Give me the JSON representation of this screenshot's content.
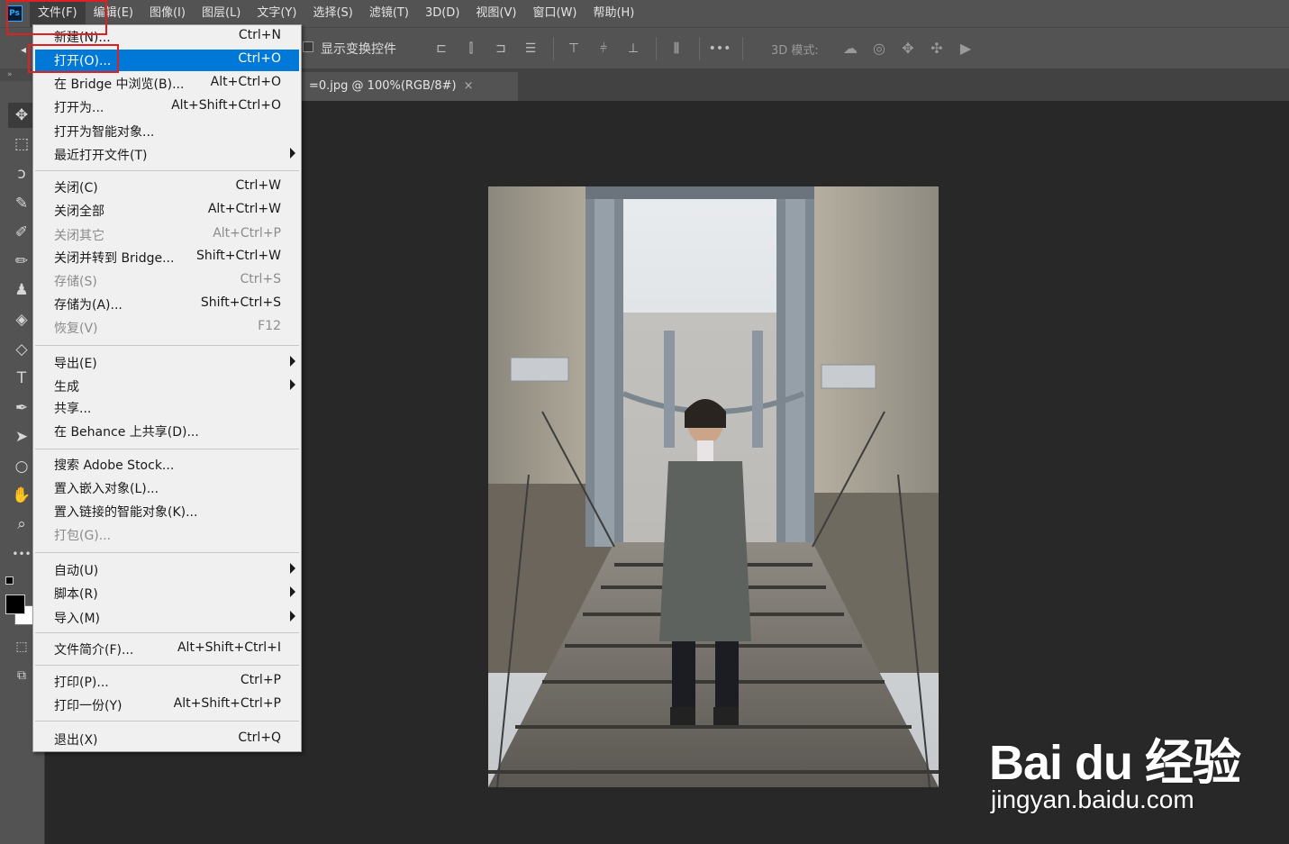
{
  "app": {
    "logo_text": "Ps"
  },
  "menubar": {
    "items": [
      "文件(F)",
      "编辑(E)",
      "图像(I)",
      "图层(L)",
      "文字(Y)",
      "选择(S)",
      "滤镜(T)",
      "3D(D)",
      "视图(V)",
      "窗口(W)",
      "帮助(H)"
    ]
  },
  "options_bar": {
    "show_transform_label": "显示变换控件",
    "show_transform_checked": false,
    "more_label": "•••",
    "mode_3d_label": "3D 模式:"
  },
  "document": {
    "tab_title": "=0.jpg @ 100%(RGB/8#)",
    "close_glyph": "×"
  },
  "file_menu": {
    "items": [
      {
        "label": "新建(N)...",
        "shortcut": "Ctrl+N",
        "disabled": false,
        "submenu": false
      },
      {
        "label": "打开(O)...",
        "shortcut": "Ctrl+O",
        "disabled": false,
        "submenu": false,
        "highlighted": true
      },
      {
        "label": "在 Bridge 中浏览(B)...",
        "shortcut": "Alt+Ctrl+O",
        "disabled": false,
        "submenu": false
      },
      {
        "label": "打开为...",
        "shortcut": "Alt+Shift+Ctrl+O",
        "disabled": false,
        "submenu": false
      },
      {
        "label": "打开为智能对象...",
        "shortcut": "",
        "disabled": false,
        "submenu": false
      },
      {
        "label": "最近打开文件(T)",
        "shortcut": "",
        "disabled": false,
        "submenu": true
      },
      {
        "label": "关闭(C)",
        "shortcut": "Ctrl+W",
        "disabled": false,
        "submenu": false
      },
      {
        "label": "关闭全部",
        "shortcut": "Alt+Ctrl+W",
        "disabled": false,
        "submenu": false
      },
      {
        "label": "关闭其它",
        "shortcut": "Alt+Ctrl+P",
        "disabled": true,
        "submenu": false
      },
      {
        "label": "关闭并转到 Bridge...",
        "shortcut": "Shift+Ctrl+W",
        "disabled": false,
        "submenu": false
      },
      {
        "label": "存储(S)",
        "shortcut": "Ctrl+S",
        "disabled": true,
        "submenu": false
      },
      {
        "label": "存储为(A)...",
        "shortcut": "Shift+Ctrl+S",
        "disabled": false,
        "submenu": false
      },
      {
        "label": "恢复(V)",
        "shortcut": "F12",
        "disabled": true,
        "submenu": false
      },
      {
        "label": "导出(E)",
        "shortcut": "",
        "disabled": false,
        "submenu": true
      },
      {
        "label": "生成",
        "shortcut": "",
        "disabled": false,
        "submenu": true
      },
      {
        "label": "共享...",
        "shortcut": "",
        "disabled": false,
        "submenu": false
      },
      {
        "label": "在 Behance 上共享(D)...",
        "shortcut": "",
        "disabled": false,
        "submenu": false
      },
      {
        "label": "搜索 Adobe Stock...",
        "shortcut": "",
        "disabled": false,
        "submenu": false
      },
      {
        "label": "置入嵌入对象(L)...",
        "shortcut": "",
        "disabled": false,
        "submenu": false
      },
      {
        "label": "置入链接的智能对象(K)...",
        "shortcut": "",
        "disabled": false,
        "submenu": false
      },
      {
        "label": "打包(G)...",
        "shortcut": "",
        "disabled": true,
        "submenu": false
      },
      {
        "label": "自动(U)",
        "shortcut": "",
        "disabled": false,
        "submenu": true
      },
      {
        "label": "脚本(R)",
        "shortcut": "",
        "disabled": false,
        "submenu": true
      },
      {
        "label": "导入(M)",
        "shortcut": "",
        "disabled": false,
        "submenu": true
      },
      {
        "label": "文件简介(F)...",
        "shortcut": "Alt+Shift+Ctrl+I",
        "disabled": false,
        "submenu": false
      },
      {
        "label": "打印(P)...",
        "shortcut": "Ctrl+P",
        "disabled": false,
        "submenu": false
      },
      {
        "label": "打印一份(Y)",
        "shortcut": "Alt+Shift+Ctrl+P",
        "disabled": false,
        "submenu": false
      },
      {
        "label": "退出(X)",
        "shortcut": "Ctrl+Q",
        "disabled": false,
        "submenu": false
      }
    ]
  },
  "tools": {
    "collapse_glyph": "»",
    "list": [
      {
        "name": "move-tool",
        "glyph": "✥"
      },
      {
        "name": "marquee-tool",
        "glyph": "⬚"
      },
      {
        "name": "lasso-tool",
        "glyph": "ↄ"
      },
      {
        "name": "quick-selection-tool",
        "glyph": "✎"
      },
      {
        "name": "eyedropper-tool",
        "glyph": "✐"
      },
      {
        "name": "brush-tool",
        "glyph": "✏"
      },
      {
        "name": "stamp-tool",
        "glyph": "♟"
      },
      {
        "name": "eraser-tool",
        "glyph": "◈"
      },
      {
        "name": "paint-bucket-tool",
        "glyph": "◇"
      },
      {
        "name": "type-tool",
        "glyph": "T"
      },
      {
        "name": "pen-tool",
        "glyph": "✒"
      },
      {
        "name": "path-selection-tool",
        "glyph": "➤"
      },
      {
        "name": "ellipse-tool",
        "glyph": "○"
      },
      {
        "name": "hand-tool",
        "glyph": "✋"
      },
      {
        "name": "zoom-tool",
        "glyph": "⌕"
      },
      {
        "name": "more-tools",
        "glyph": "•••"
      }
    ]
  },
  "watermark": {
    "line1": "Bai du 经验",
    "line2": "jingyan.baidu.com"
  },
  "colors": {
    "menu_highlight": "#0078d7",
    "annotation_red": "#e02020",
    "panel_bg": "#535353",
    "canvas_bg": "#282828"
  }
}
